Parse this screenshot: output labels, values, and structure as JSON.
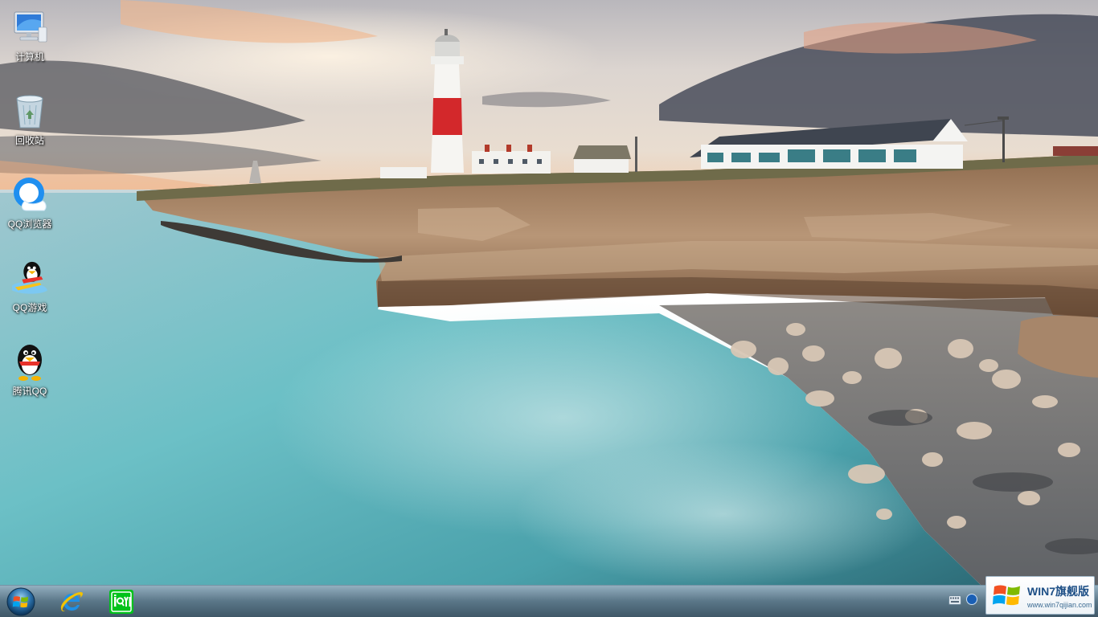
{
  "desktop": {
    "icons": [
      {
        "label": "计算机",
        "icon": "computer-icon"
      },
      {
        "label": "回收站",
        "icon": "recycle-bin-icon"
      },
      {
        "label": "QQ浏览器",
        "icon": "qq-browser-icon"
      },
      {
        "label": "QQ游戏",
        "icon": "qq-game-icon"
      },
      {
        "label": "腾讯QQ",
        "icon": "qq-penguin-icon"
      }
    ]
  },
  "taskbar": {
    "start": {
      "icon": "windows-start-orb-icon"
    },
    "pinned": [
      {
        "icon": "internet-explorer-icon"
      },
      {
        "icon": "iqiyi-icon"
      }
    ],
    "tray": [
      {
        "icon": "keyboard-icon"
      },
      {
        "icon": "tray-app-icon"
      }
    ]
  },
  "watermark": {
    "title": "WIN7旗舰版",
    "url": "www.win7qijian.com",
    "icon": "windows-flag-icon"
  },
  "colors": {
    "taskbar": "#1d4a66",
    "sky": "#d9d4cf",
    "sea": "#5fb6b8",
    "cliff": "#9c7556",
    "lighthouse_red": "#d3282b"
  }
}
